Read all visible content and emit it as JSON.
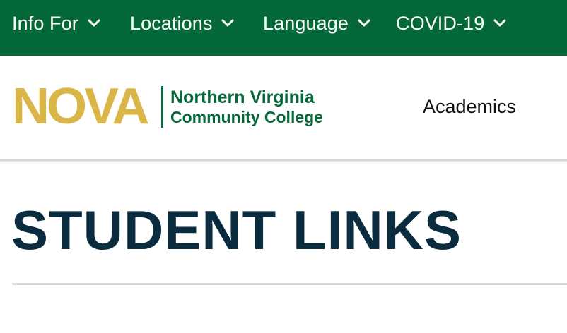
{
  "topnav": {
    "items": [
      {
        "label": "Info For"
      },
      {
        "label": "Locations"
      },
      {
        "label": "Language"
      },
      {
        "label": "COVID-19"
      }
    ]
  },
  "logo": {
    "wordmark": "NOVA",
    "line1": "Northern Virginia",
    "line2": "Community College"
  },
  "main_nav": {
    "academics_label": "Academics"
  },
  "page": {
    "title": "STUDENT LINKS"
  },
  "colors": {
    "brand_green": "#056839",
    "brand_gold": "#d9b647",
    "title_navy": "#0b2b3f"
  },
  "icons": {
    "dropdown": "chevron-down-icon"
  }
}
